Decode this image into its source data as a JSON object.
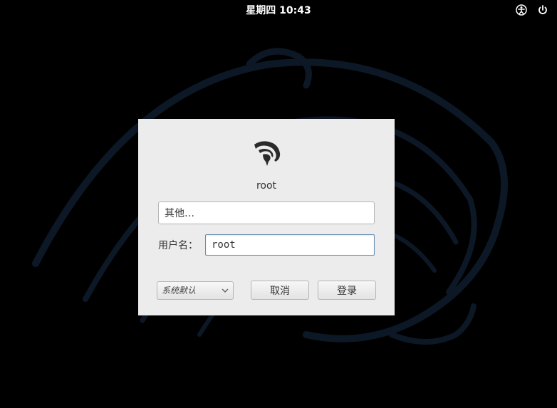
{
  "topbar": {
    "clock": "星期四 10:43"
  },
  "login": {
    "current_user": "root",
    "other_user_label": "其他…",
    "username_label": "用户名：",
    "username_value": "root",
    "session_select": "系统默认",
    "cancel_button": "取消",
    "login_button": "登录"
  }
}
